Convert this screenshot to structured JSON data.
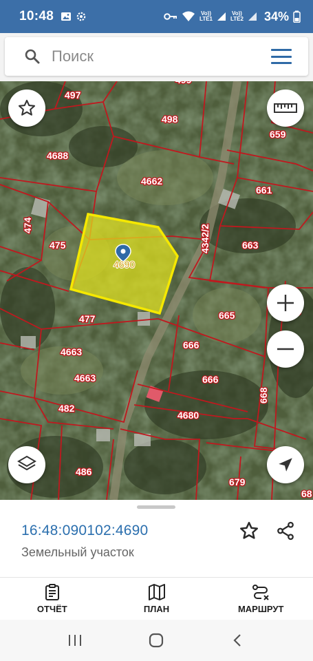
{
  "status_bar": {
    "time": "10:48",
    "sim1": "Vo))\nLTE1",
    "sim2": "Vo))\nLTE2",
    "battery": "34%"
  },
  "search": {
    "placeholder": "Поиск"
  },
  "map": {
    "parcels": [
      "497",
      "498",
      "659",
      "4688",
      "4662",
      "661",
      "474",
      "475",
      "663",
      "4342/2",
      "477",
      "665",
      "668",
      "4663",
      "666",
      "4663",
      "666",
      "668",
      "482",
      "4680",
      "486",
      "679",
      "68"
    ],
    "selected_parcel_label": "4690",
    "selected_fill": "#e6e61c",
    "selected_stroke": "#f5e800",
    "boundary_color": "#c0181e",
    "pin_color": "#2f6aa6"
  },
  "parcel_info": {
    "cadastral_number": "16:48:090102:4690",
    "type": "Земельный участок"
  },
  "bottom_nav": {
    "report": "ОТЧЁТ",
    "plan": "ПЛАН",
    "route": "МАРШРУТ"
  },
  "icons": {
    "search": "search-icon",
    "menu": "menu-icon",
    "favorite": "star-icon",
    "ruler": "ruler-icon",
    "layers": "layers-icon",
    "zoom_in": "plus-icon",
    "zoom_out": "minus-icon",
    "locate": "navigation-arrow-icon",
    "share": "share-icon",
    "report": "clipboard-icon",
    "plan": "map-icon",
    "route": "route-icon"
  }
}
